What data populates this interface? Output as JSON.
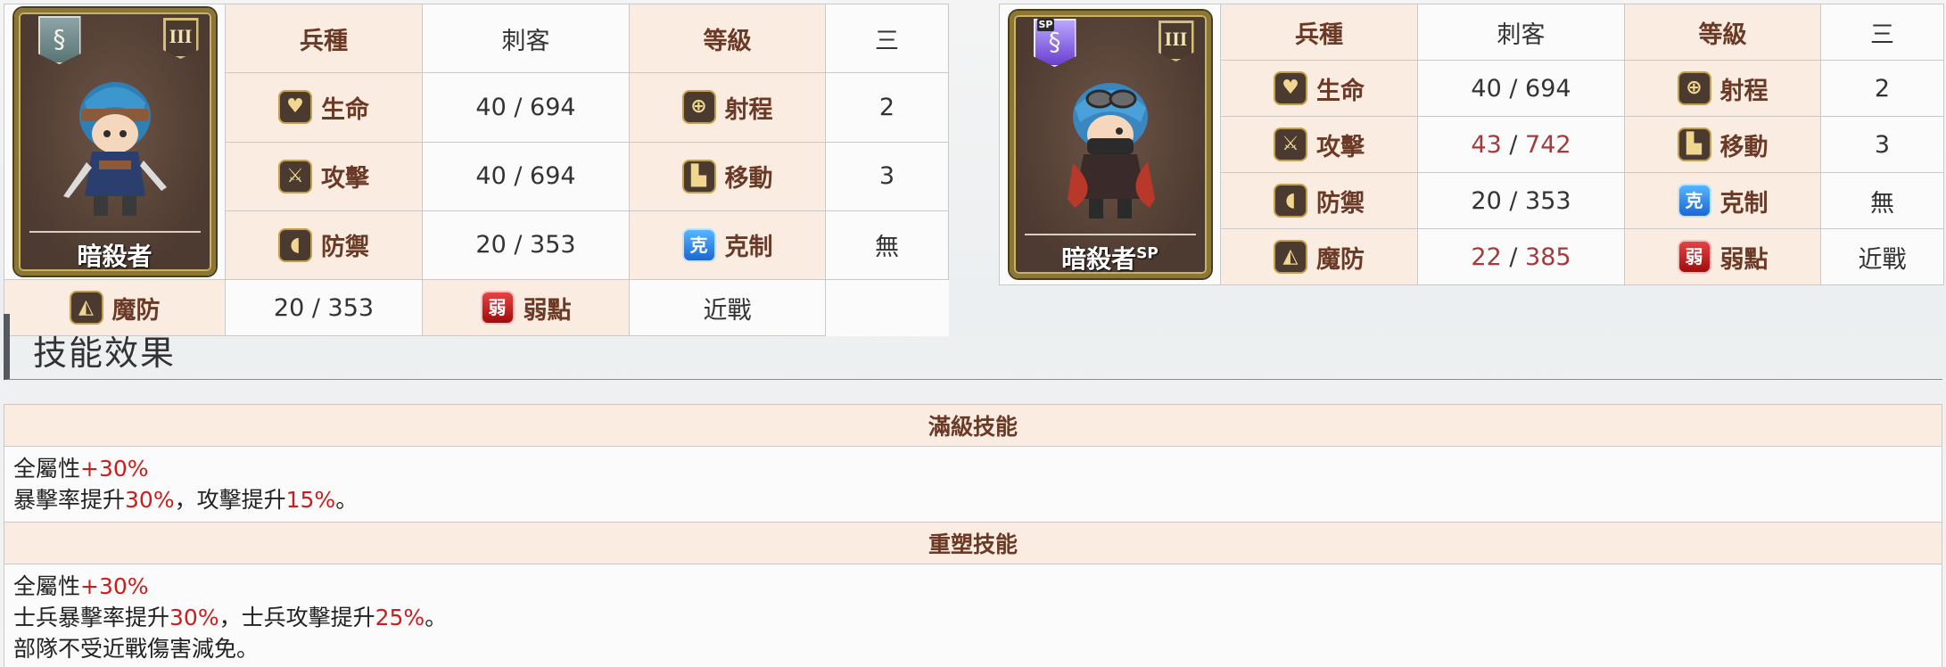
{
  "units": [
    {
      "name": "暗殺者",
      "name_sup": "",
      "rank": "III",
      "class_icon": "serpent-emblem-icon",
      "type_label": "兵種",
      "type_value": "刺客",
      "level_label": "等級",
      "level_value": "三",
      "stats": {
        "hp": {
          "label": "生命",
          "a": "40",
          "b": "694"
        },
        "atk": {
          "label": "攻擊",
          "a": "40",
          "b": "694"
        },
        "def": {
          "label": "防禦",
          "a": "20",
          "b": "353"
        },
        "mdef": {
          "label": "魔防",
          "a": "20",
          "b": "353"
        }
      },
      "props": {
        "range": {
          "label": "射程",
          "value": "2"
        },
        "move": {
          "label": "移動",
          "value": "3"
        },
        "counter": {
          "label": "克制",
          "value": "無",
          "icon_text": "克"
        },
        "weak": {
          "label": "弱點",
          "value": "近戰",
          "icon_text": "弱"
        }
      }
    },
    {
      "name": "暗殺者",
      "name_sup": "SP",
      "sp_tag": "SP",
      "rank": "III",
      "class_icon": "serpent-emblem-sp-icon",
      "type_label": "兵種",
      "type_value": "刺客",
      "level_label": "等級",
      "level_value": "三",
      "stats": {
        "hp": {
          "label": "生命",
          "a": "40",
          "b": "694"
        },
        "atk": {
          "label": "攻擊",
          "a": "43",
          "b": "742"
        },
        "def": {
          "label": "防禦",
          "a": "20",
          "b": "353"
        },
        "mdef": {
          "label": "魔防",
          "a": "22",
          "b": "385"
        }
      },
      "props": {
        "range": {
          "label": "射程",
          "value": "2"
        },
        "move": {
          "label": "移動",
          "value": "3"
        },
        "counter": {
          "label": "克制",
          "value": "無",
          "icon_text": "克"
        },
        "weak": {
          "label": "弱點",
          "value": "近戰",
          "icon_text": "弱"
        }
      }
    }
  ],
  "skills_section": {
    "title": "技能效果",
    "max": {
      "title": "滿級技能",
      "l1_a": "全屬性",
      "l1_b": "+30%",
      "l2_a": "暴擊率提升",
      "l2_b": "30%",
      "l2_c": "，攻擊提升",
      "l2_d": "15%",
      "l2_e": "。"
    },
    "reforge": {
      "title": "重塑技能",
      "l1_a": "全屬性",
      "l1_b": "+30%",
      "l2_a": "士兵暴擊率提升",
      "l2_b": "30%",
      "l2_c": "，士兵攻擊提升",
      "l2_d": "25%",
      "l2_e": "。",
      "l3": "部隊不受近戰傷害減免。"
    }
  },
  "colors": {
    "header_bg": "#fbece2",
    "header_text": "#6b3a26",
    "highlight": "#cc1d1d",
    "boosted_stat": "#a53a3a"
  }
}
